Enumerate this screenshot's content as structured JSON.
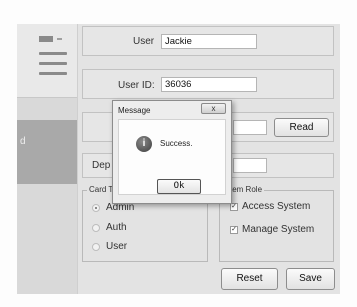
{
  "sidebar": {
    "selected_item_label": "d"
  },
  "form": {
    "user_label": "User",
    "user_value": "Jackie",
    "userid_label": "User ID:",
    "userid_value": "36036",
    "read_button": "Read",
    "dept_label": "Dep",
    "card_type": {
      "title": "Card Ty",
      "options": [
        "Admin",
        "Auth",
        "User"
      ],
      "selected": "Admin"
    },
    "system_role": {
      "title": "stem Role",
      "options": [
        {
          "label": "Access System",
          "checked": true
        },
        {
          "label": "Manage System",
          "checked": true
        }
      ]
    },
    "reset_button": "Reset",
    "save_button": "Save"
  },
  "dialog": {
    "title": "Message",
    "close_glyph": "x",
    "message": "Success.",
    "icon": "info-icon",
    "ok_button": "Ok"
  }
}
